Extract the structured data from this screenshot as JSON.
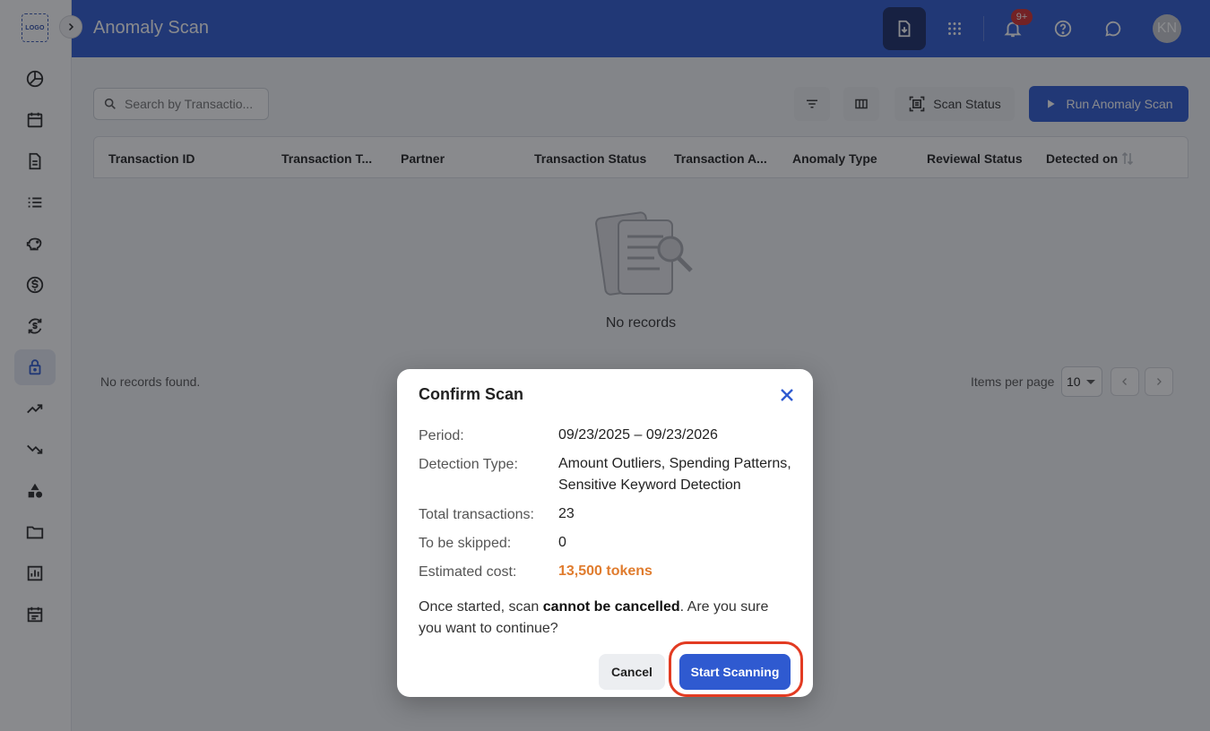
{
  "app": {
    "logo_text": "LOGO",
    "title": "Anomaly Scan"
  },
  "colors": {
    "primary": "#2f5ad0",
    "header_dark_button": "#1b2d68",
    "badge": "#d32f2f",
    "cost": "#e07c2e",
    "highlight_ring": "#e23b22"
  },
  "sidebar": {
    "items": [
      {
        "icon": "pie-chart-icon"
      },
      {
        "icon": "calendar-icon"
      },
      {
        "icon": "document-icon"
      },
      {
        "icon": "list-icon"
      },
      {
        "icon": "piggy-bank-icon"
      },
      {
        "icon": "dollar-circle-icon"
      },
      {
        "icon": "currency-exchange-icon"
      },
      {
        "icon": "lock-icon",
        "active": true
      },
      {
        "icon": "trending-up-icon"
      },
      {
        "icon": "trending-down-icon"
      },
      {
        "icon": "shapes-icon"
      },
      {
        "icon": "folder-icon"
      },
      {
        "icon": "bar-chart-icon"
      },
      {
        "icon": "event-note-icon"
      }
    ]
  },
  "header": {
    "notification_badge": "9+",
    "avatar_initials": "KN"
  },
  "toolbar": {
    "search_placeholder": "Search by Transactio...",
    "scan_status_label": "Scan Status",
    "run_scan_label": "Run Anomaly Scan"
  },
  "table": {
    "columns": [
      "Transaction ID",
      "Transaction T...",
      "Partner",
      "Transaction Status",
      "Transaction A...",
      "Anomaly Type",
      "Reviewal Status",
      "Detected on"
    ],
    "empty_message": "No records",
    "footer_text": "No records found.",
    "items_per_page_label": "Items per page",
    "items_per_page_value": "10"
  },
  "modal": {
    "title": "Confirm Scan",
    "period_label": "Period:",
    "period_value": "09/23/2025 – 09/23/2026",
    "detection_label": "Detection Type:",
    "detection_value_line1": "Amount Outliers, Spending Patterns,",
    "detection_value_line2": "Sensitive Keyword Detection",
    "total_label": "Total transactions:",
    "total_value": "23",
    "skipped_label": "To be skipped:",
    "skipped_value": "0",
    "cost_label": "Estimated cost:",
    "cost_value": "13,500 tokens",
    "confirm_prefix": "Once started, scan ",
    "confirm_bold": "cannot be cancelled",
    "confirm_suffix": ". Are you sure you want to continue?",
    "cancel_label": "Cancel",
    "start_label": "Start Scanning"
  }
}
